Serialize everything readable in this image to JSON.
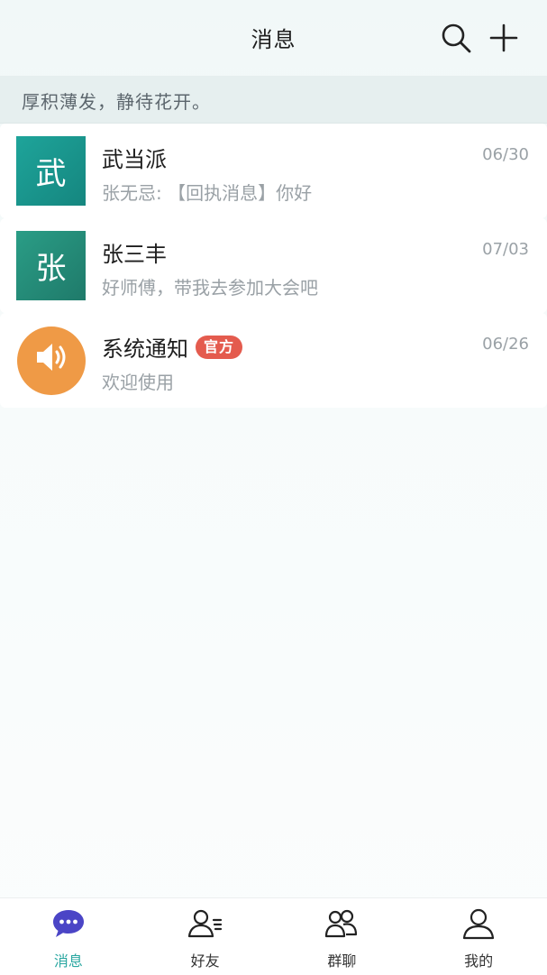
{
  "header": {
    "title": "消息",
    "search_icon": "search-icon",
    "add_icon": "plus-icon"
  },
  "motto": "厚积薄发，静待花开。",
  "conversations": [
    {
      "avatar_text": "武",
      "name": "武当派",
      "preview": "张无忌: 【回执消息】你好",
      "time": "06/30",
      "avatar_color": "#1a978e"
    },
    {
      "avatar_text": "张",
      "name": "张三丰",
      "preview": "好师傅，带我去参加大会吧",
      "time": "07/03",
      "avatar_color": "#248b78"
    },
    {
      "avatar_icon": "speaker-icon",
      "name": "系统通知",
      "badge": "官方",
      "preview": "欢迎使用",
      "time": "06/26",
      "avatar_color": "#ef9a46",
      "badge_color": "#e45b4e"
    }
  ],
  "tabs": [
    {
      "label": "消息",
      "icon": "chat-bubble-icon",
      "active": true
    },
    {
      "label": "好友",
      "icon": "contacts-icon",
      "active": false
    },
    {
      "label": "群聊",
      "icon": "group-icon",
      "active": false
    },
    {
      "label": "我的",
      "icon": "user-icon",
      "active": false
    }
  ],
  "colors": {
    "accent": "#2aa7a1",
    "active_tab_icon": "#4b45c6"
  }
}
